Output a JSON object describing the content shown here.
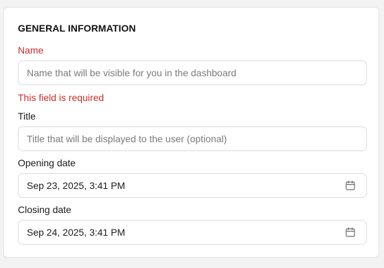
{
  "section": {
    "title": "GENERAL INFORMATION"
  },
  "name_field": {
    "label": "Name",
    "placeholder": "Name that will be visible for you in the dashboard",
    "error": "This field is required"
  },
  "title_field": {
    "label": "Title",
    "placeholder": "Title that will be displayed to the user (optional)"
  },
  "opening_date": {
    "label": "Opening date",
    "value": "Sep 23, 2025, 3:41 PM",
    "icon": "calendar-icon"
  },
  "closing_date": {
    "label": "Closing date",
    "value": "Sep 24, 2025, 3:41 PM",
    "icon": "calendar-icon"
  },
  "colors": {
    "error": "#cc2b2b",
    "border": "#dcdce0",
    "background": "#f3f3f4"
  }
}
